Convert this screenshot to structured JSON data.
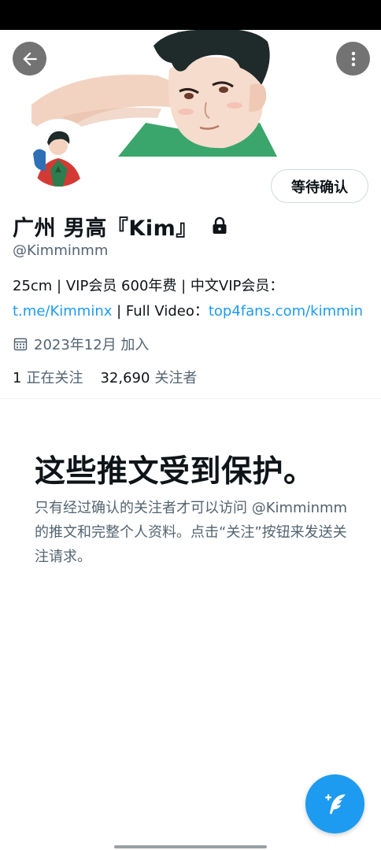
{
  "profile": {
    "display_name": "广州 男高『Kim』",
    "handle": "@Kimminmm",
    "pending_label": "等待确认",
    "bio_part1": "25cm | VIP会员 600年费  |  中文VIP会员：",
    "bio_link1": "t.me/Kimminx",
    "bio_part2": "  |  Full Video：",
    "bio_link2": "top4fans.com/kimmin",
    "joined": "2023年12月 加入",
    "following_count": "1",
    "following_label": "正在关注",
    "followers_count": "32,690",
    "followers_label": "关注者"
  },
  "protected": {
    "title": "这些推文受到保护。",
    "body": "只有经过确认的关注者才可以访问 @Kimminmm 的推文和完整个人资料。点击“关注”按钮来发送关注请求。"
  },
  "icons": {
    "back": "arrow-left-icon",
    "more": "more-vertical-icon",
    "lock": "lock-icon",
    "calendar": "calendar-icon",
    "compose": "compose-feather-icon"
  },
  "colors": {
    "accent": "#1d9bf0",
    "text_primary": "#0f1419",
    "text_secondary": "#536471",
    "border": "#cfd9de"
  }
}
